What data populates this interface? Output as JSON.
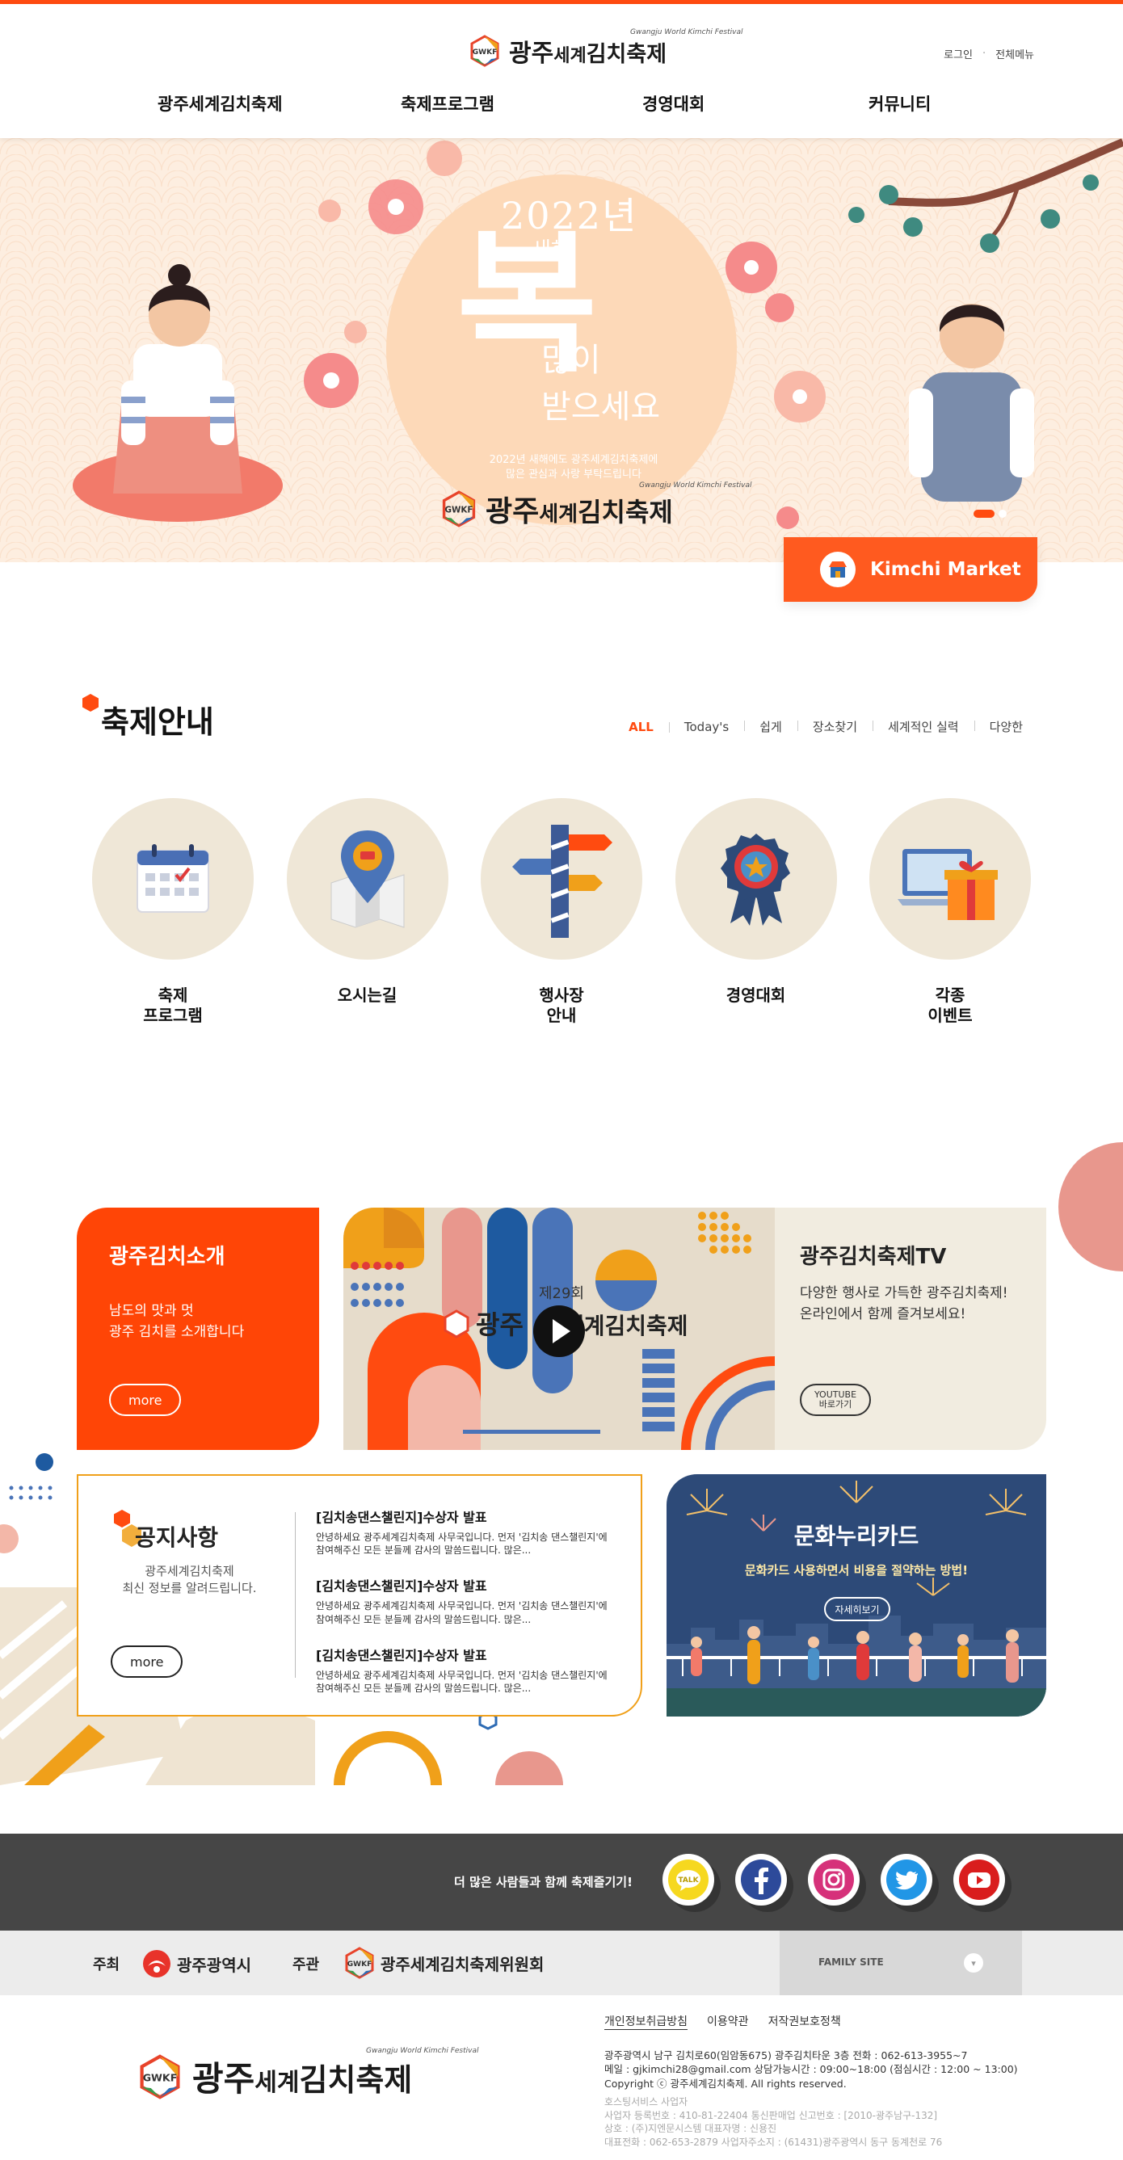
{
  "header": {
    "logo_gwkf": "GWKF",
    "logo_main": "광주세계김치축제",
    "logo_gwang": "광주",
    "logo_segye": "세계",
    "logo_kimchi": "김치축제",
    "logo_sub": "Gwangju World Kimchi Festival",
    "login": "로그인",
    "all_menu": "전체메뉴",
    "nav": [
      "광주세계김치축제",
      "축제프로그램",
      "경영대회",
      "커뮤니티"
    ]
  },
  "hero": {
    "year": "2022년",
    "new": "새해",
    "bok": "복",
    "manhi": "많이",
    "badeuseyo": "받으세요",
    "small": "2022년 새해에도 광주세계김치축제에\n많은 관심과 사랑 부탁드립니다",
    "kimchi_market": "Kimchi Market"
  },
  "guide": {
    "title": "축제안내",
    "tabs": [
      "ALL",
      "Today's",
      "쉽게",
      "장소찾기",
      "세계적인 실력",
      "다양한"
    ],
    "active_tab": "ALL",
    "items": [
      {
        "label": "축제\n프로그램",
        "icon": "calendar-icon"
      },
      {
        "label": "오시는길",
        "icon": "map-pin-icon"
      },
      {
        "label": "행사장\n안내",
        "icon": "signpost-icon"
      },
      {
        "label": "경영대회",
        "icon": "medal-icon"
      },
      {
        "label": "각종\n이벤트",
        "icon": "gift-icon"
      }
    ]
  },
  "intro": {
    "title": "광주김치소개",
    "desc": "남도의 맛과 멋\n광주 김치를 소개합니다",
    "more": "more"
  },
  "tv": {
    "thumb_caption": "제29회",
    "thumb_logo_gwang": "광주",
    "thumb_logo_rest": "세계김치축제",
    "title": "광주김치축제TV",
    "desc": "다양한 행사로 가득한 광주김치축제!\n온라인에서 함께 즐겨보세요!",
    "btn_line1": "YOUTUBE",
    "btn_line2": "바로가기"
  },
  "notice": {
    "title": "공지사항",
    "desc": "광주세계김치축제\n최신 정보를 알려드립니다.",
    "more": "more",
    "items": [
      {
        "title": "[김치송댄스챌린지]수상자 발표",
        "body": "안녕하세요 광주세계김치축제 사무국입니다. 먼저 '김치송 댄스챌린지'에 참여해주신 모든 분들께 감사의 말씀드립니다. 많은..."
      },
      {
        "title": "[김치송댄스챌린지]수상자 발표",
        "body": "안녕하세요 광주세계김치축제 사무국입니다. 먼저 '김치송 댄스챌린지'에 참여해주신 모든 분들께 감사의 말씀드립니다. 많은..."
      },
      {
        "title": "[김치송댄스챌린지]수상자 발표",
        "body": "안녕하세요 광주세계김치축제 사무국입니다. 먼저 '김치송 댄스챌린지'에 참여해주신 모든 분들께 감사의 말씀드립니다. 많은..."
      }
    ]
  },
  "culture": {
    "title": "문화누리카드",
    "desc": "문화카드 사용하면서 비용을 절약하는 방법!",
    "view": "자세히보기"
  },
  "sns": {
    "text": "더 많은 사람들과 함께 축제즐기기!",
    "talk": "TALK",
    "icons": [
      "kakaotalk-icon",
      "facebook-icon",
      "instagram-icon",
      "twitter-icon",
      "youtube-icon"
    ]
  },
  "sponsor": {
    "host_label": "주최",
    "host": "광주광역시",
    "organizer_label": "주관",
    "organizer": "광주세계김치축제위원회",
    "family_site": "FAMILY SITE"
  },
  "footer": {
    "links": [
      "개인정보취급방침",
      "이용약관",
      "저작권보호정책"
    ],
    "info": "광주광역시 남구 김치로60(임암동675) 광주김치타운 3층 전화 : 062-613-3955~7\n메일 : gjkimchi28@gmail.com 상담가능시간 : 09:00~18:00 (점심시간 : 12:00 ~ 13:00)\nCopyright ⓒ 광주세계김치축제. All rights reserved.",
    "biz": "호스팅서비스 사업자\n사업자 등록번호 : 410-81-22404 통신판매업 신고번호 : [2010-광주남구-132]\n상호 : (주)지엔문시스템 대표자명 : 신용진\n대표전화 : 062-653-2879 사업자주소지 : (61431)광주광역시 동구 동계천로 76"
  },
  "colors": {
    "accent": "#ff4b10",
    "notice_border": "#f0a01a",
    "culture_bg": "#2d4a78",
    "hero_bg": "#fdeee0"
  }
}
